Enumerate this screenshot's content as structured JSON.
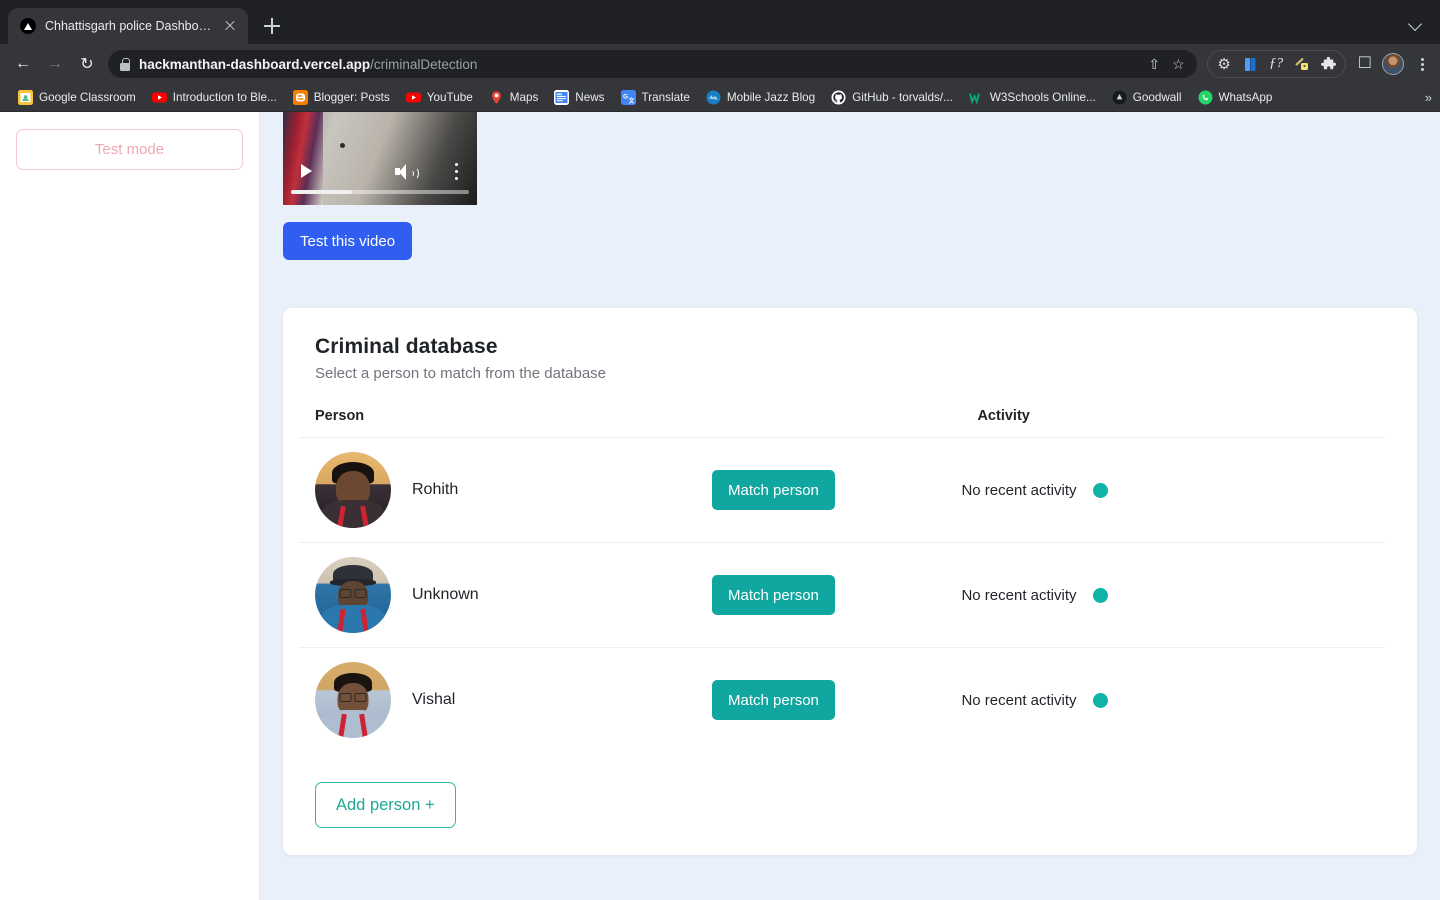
{
  "browser": {
    "tab": {
      "title": "Chhattisgarh police Dashboard",
      "favicon": "vercel-triangle-icon",
      "close_label": "×"
    },
    "new_tab_label": "+",
    "tab_list_label": "v",
    "nav": {
      "back": "←",
      "forward": "→",
      "reload": "↻"
    },
    "omnibox": {
      "lock": "lock-icon",
      "url_host": "hackmanthan-dashboard.vercel.app",
      "url_path": "/criminalDetection",
      "share": "⇧",
      "bookmark_star": "☆"
    },
    "extensions": [
      {
        "name": "gear-icon",
        "glyph": "⚙"
      },
      {
        "name": "blue-book-icon",
        "glyph": "▌"
      },
      {
        "name": "function-icon",
        "glyph": "ƒ?"
      },
      {
        "name": "key-lock-icon",
        "glyph": "⚿"
      },
      {
        "name": "puzzle-piece-icon",
        "glyph": "❖"
      }
    ],
    "side_panel": "□",
    "profile": "avatar",
    "menu": "⋮",
    "bookmarks": [
      {
        "label": "Google Classroom",
        "icon": "classroom",
        "color": "#f9c23c"
      },
      {
        "label": "Introduction to Ble...",
        "icon": "youtube",
        "color": "#ff0000"
      },
      {
        "label": "Blogger: Posts",
        "icon": "blogger",
        "color": "#f57d00"
      },
      {
        "label": "YouTube",
        "icon": "youtube",
        "color": "#ff0000"
      },
      {
        "label": "Maps",
        "icon": "maps",
        "color": "#34a853"
      },
      {
        "label": "News",
        "icon": "news",
        "color": "#4285f4"
      },
      {
        "label": "Translate",
        "icon": "translate",
        "color": "#4285f4"
      },
      {
        "label": "Mobile Jazz Blog",
        "icon": "globe",
        "color": "#1b7fc4"
      },
      {
        "label": "GitHub - torvalds/...",
        "icon": "github",
        "color": "#ffffff"
      },
      {
        "label": "W3Schools Online...",
        "icon": "w3schools",
        "color": "#04aa6d"
      },
      {
        "label": "Goodwall",
        "icon": "goodwall",
        "color": "#ffffff"
      },
      {
        "label": "WhatsApp",
        "icon": "whatsapp",
        "color": "#25d366"
      }
    ],
    "bookmarks_overflow": "»"
  },
  "sidebar": {
    "test_mode_label": "Test mode"
  },
  "video": {
    "play_label": "play-icon",
    "volume_label": "volume-icon",
    "more_label": "more-options-icon",
    "progress_percent": 34
  },
  "main": {
    "test_video_label": "Test this video",
    "card": {
      "title": "Criminal database",
      "subtitle": "Select a person to match from the database",
      "columns": {
        "person": "Person",
        "activity": "Activity"
      },
      "rows": [
        {
          "name": "Rohith",
          "match_label": "Match person",
          "activity": "No recent activity",
          "status_color": "#10b3a8",
          "avatar": "rohith"
        },
        {
          "name": "Unknown",
          "match_label": "Match person",
          "activity": "No recent activity",
          "status_color": "#10b3a8",
          "avatar": "unknown"
        },
        {
          "name": "Vishal",
          "match_label": "Match person",
          "activity": "No recent activity",
          "status_color": "#10b3a8",
          "avatar": "vishal"
        }
      ],
      "add_person_label": "Add person +"
    }
  },
  "colors": {
    "accent_teal": "#10a7a0",
    "status_teal": "#10b3a8",
    "primary_blue": "#2f5ef0",
    "test_mode_pink": "#f0a8b0",
    "page_bg": "#e9f0fa"
  }
}
